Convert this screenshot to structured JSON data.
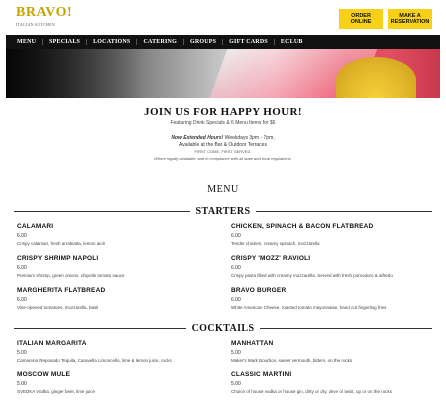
{
  "brand": {
    "name": "BRAVO!",
    "tagline": "ITALIAN KITCHEN",
    "accent": "#f7d117"
  },
  "header": {
    "order_label": "ORDER ONLINE",
    "reserve_label": "MAKE A RESERVATION"
  },
  "nav": {
    "items": [
      "MENU",
      "SPECIALS",
      "LOCATIONS",
      "CATERING",
      "GROUPS",
      "GIFT CARDS",
      "ECLUB"
    ]
  },
  "happy_hour": {
    "title": "JOIN US FOR HAPPY HOUR!",
    "subtitle": "Featuring Drink Specials & 6 Menu Items for $6",
    "extended_bold": "Now Extended Hours!",
    "extended_rest": " Weekdays 3pm - 7pm,",
    "availability": "Available at the Bar & Outdoor Terraces",
    "first_come": "FIRST COME, FIRST SERVED.",
    "note": "Where legally available, and in compliance with all state and local regulations."
  },
  "menu": {
    "title": "MENU",
    "sections": [
      {
        "label": "STARTERS",
        "items": [
          {
            "name": "CALAMARI",
            "price": "6.00",
            "desc": "Crispy calamari, fresh arrabiatta, lemon aioli"
          },
          {
            "name": "CHICKEN, SPINACH & BACON FLATBREAD",
            "price": "6.00",
            "desc": "Tender chicken, creamy spinach, mozzarella"
          },
          {
            "name": "CRISPY SHRIMP NAPOLI",
            "price": "6.00",
            "desc": "Premium shrimp, green onions, chipotle tomato sauce"
          },
          {
            "name": "CRISPY 'MOZZ' RAVIOLI",
            "price": "6.00",
            "desc": "Crispy pasta filled with creamy mozzarella. Served with fresh pomodoro & alfredo"
          },
          {
            "name": "MARGHERITA FLATBREAD",
            "price": "6.00",
            "desc": "Vine-ripened tomatoes, mozzarella, basil"
          },
          {
            "name": "BRAVO BURGER",
            "price": "6.00",
            "desc": "White American Cheese, roasted tomato mayonnaise, hand cut fingerling fries"
          }
        ]
      },
      {
        "label": "COCKTAILS",
        "items": [
          {
            "name": "ITALIAN MARGARITA",
            "price": "5.00",
            "desc": "Camarena Reposado Tequila, Caravella Limoncello, lime & lemon juice, rocks"
          },
          {
            "name": "MANHATTAN",
            "price": "5.00",
            "desc": "Maker's Mark Bourbon, sweet vermouth, bitters, on the rocks"
          },
          {
            "name": "MOSCOW MULE",
            "price": "5.00",
            "desc": "SVEDKA Vodka, ginger beer, lime juice"
          },
          {
            "name": "CLASSIC MARTINI",
            "price": "5.00",
            "desc": "Choice of house vodka or house gin, dirty or dry, olive or twist, up or on the rocks"
          }
        ]
      }
    ]
  }
}
